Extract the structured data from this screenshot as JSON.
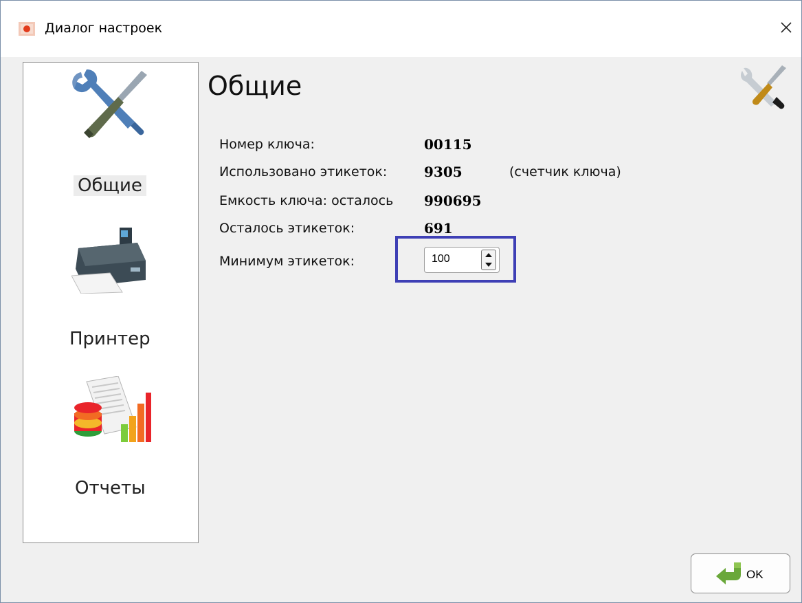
{
  "window": {
    "title": "Диалог настроек",
    "app_icon": "app-logo-icon",
    "close_icon": "close-icon"
  },
  "sidebar": {
    "items": [
      {
        "label": "Общие",
        "icon": "tools-icon",
        "selected": true
      },
      {
        "label": "Принтер",
        "icon": "printer-icon",
        "selected": false
      },
      {
        "label": "Отчеты",
        "icon": "reports-icon",
        "selected": false
      }
    ]
  },
  "main": {
    "heading": "Общие",
    "heading_icon": "tools-icon",
    "rows": [
      {
        "label": "Номер ключа:",
        "value": "00115"
      },
      {
        "label": "Использовано этикеток:",
        "value": "9305",
        "note": "(счетчик ключа)"
      },
      {
        "label": "Емкость ключа: осталось",
        "value": "990695"
      },
      {
        "label": "Осталось этикеток:",
        "value": "691"
      }
    ],
    "min_labels": {
      "label": "Минимум этикеток:",
      "value": "100",
      "highlight_color": "#3e3fb5"
    }
  },
  "footer": {
    "ok_label": "OK",
    "ok_icon": "green-arrow-icon"
  }
}
